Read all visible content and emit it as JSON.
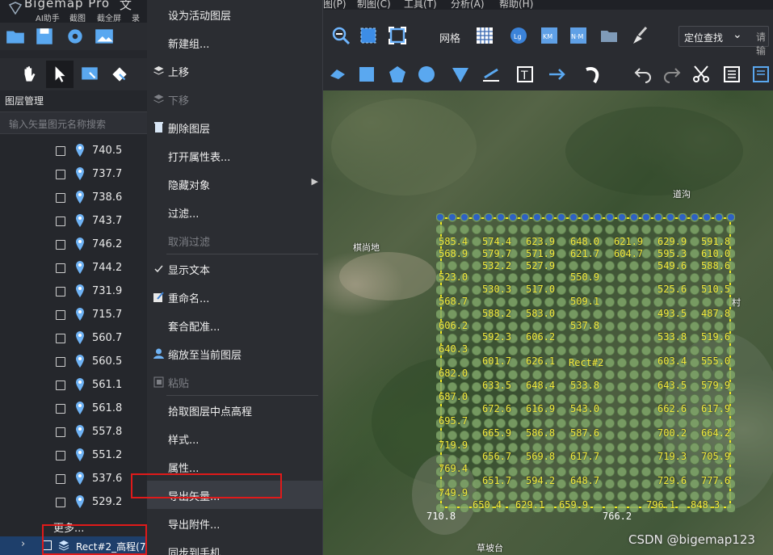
{
  "app": {
    "title": "Bigemap Pro",
    "tabs": [
      "AI助手",
      "截图",
      "截全屏",
      "录屏"
    ],
    "title_suffix": "文"
  },
  "left_panel": {
    "title": "图层管理",
    "search_placeholder": "输入矢量图元名称搜索",
    "rows": [
      "740.5",
      "737.7",
      "738.6",
      "743.7",
      "746.2",
      "744.2",
      "731.9",
      "715.7",
      "560.7",
      "560.5",
      "561.1",
      "561.8",
      "557.8",
      "551.2",
      "537.6",
      "529.2"
    ],
    "more": "更多...",
    "selected_layer": "Rect#2_高程(7"
  },
  "context_menu": {
    "items": [
      {
        "label": "设为活动图层",
        "disabled": false,
        "icon": ""
      },
      {
        "label": "新建组...",
        "disabled": false,
        "icon": ""
      },
      {
        "label": "上移",
        "disabled": false,
        "icon": "layers-up-icon"
      },
      {
        "label": "下移",
        "disabled": true,
        "icon": "layers-down-icon"
      },
      {
        "label": "删除图层",
        "disabled": false,
        "icon": "trash-icon"
      },
      {
        "label": "打开属性表...",
        "disabled": false,
        "icon": ""
      },
      {
        "label": "隐藏对象",
        "disabled": false,
        "icon": "",
        "submenu": true
      },
      {
        "label": "过滤...",
        "disabled": false,
        "icon": ""
      },
      {
        "label": "取消过滤",
        "disabled": true,
        "icon": ""
      },
      {
        "label": "显示文本",
        "disabled": false,
        "icon": "check-icon"
      },
      {
        "label": "重命名...",
        "disabled": false,
        "icon": "rename-icon"
      },
      {
        "label": "套合配准...",
        "disabled": false,
        "icon": ""
      },
      {
        "label": "缩放至当前图层",
        "disabled": false,
        "icon": "user-zoom-icon"
      },
      {
        "label": "粘贴",
        "disabled": true,
        "icon": "paste-icon"
      },
      {
        "label": "拾取图层中点高程",
        "disabled": false,
        "icon": ""
      },
      {
        "label": "样式...",
        "disabled": false,
        "icon": ""
      },
      {
        "label": "属性...",
        "disabled": false,
        "icon": ""
      },
      {
        "label": "导出矢量...",
        "disabled": false,
        "icon": ""
      },
      {
        "label": "导出附件...",
        "disabled": false,
        "icon": ""
      },
      {
        "label": "同步到手机",
        "disabled": false,
        "icon": ""
      }
    ]
  },
  "menubar": [
    "图(P)",
    "制图(C)",
    "工具(T)",
    "分析(A)",
    "帮助(H)"
  ],
  "toolbar": {
    "grid_label": "网格",
    "locate_label": "定位查找",
    "search_hint": "请输"
  },
  "map": {
    "place_names": [
      "道沟",
      "棋尚地",
      "村",
      "草坡台"
    ],
    "rect_label": "Rect#2",
    "bottom_values": [
      "710.8",
      "766.2"
    ],
    "elevation_rows": [
      [
        "585.4",
        "574.4",
        "623.9",
        "648.0",
        "621.9",
        "629.9",
        "591.8"
      ],
      [
        "568.9",
        "579.7",
        "571.9",
        "621.7",
        "604.7",
        "595.3",
        "610.0"
      ],
      [
        "532.2",
        "527.9",
        "549.6",
        "588.6"
      ],
      [
        "523.0",
        "550.9"
      ],
      [
        "530.3",
        "517.0",
        "525.6",
        "510.5"
      ],
      [
        "568.7",
        "509.1"
      ],
      [
        "588.2",
        "583.0",
        "493.5",
        "487.8"
      ],
      [
        "606.2",
        "537.8"
      ],
      [
        "592.3",
        "606.2",
        "533.8",
        "519.6"
      ],
      [
        "640.3"
      ],
      [
        "601.7",
        "626.1",
        "603.4",
        "555.0"
      ],
      [
        "682.0"
      ],
      [
        "633.5",
        "648.4",
        "533.8",
        "643.5",
        "579.9"
      ],
      [
        "687.0"
      ],
      [
        "672.6",
        "616.9",
        "543.0",
        "662.6",
        "617.9"
      ],
      [
        "695.7"
      ],
      [
        "665.9",
        "586.8",
        "587.6",
        "700.2",
        "664.2"
      ],
      [
        "719.9"
      ],
      [
        "656.7",
        "569.8",
        "617.7",
        "719.3",
        "705.9"
      ],
      [
        "769.4"
      ],
      [
        "651.7",
        "594.2",
        "648.7",
        "729.6",
        "777.6"
      ],
      [
        "749.9"
      ],
      [
        "650.4",
        "629.1",
        "659.9",
        "796.1",
        "848.3"
      ]
    ]
  },
  "watermark": "CSDN @bigemap123"
}
